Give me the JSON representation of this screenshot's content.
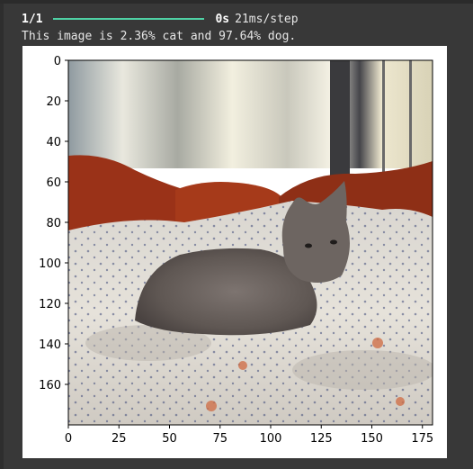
{
  "output": {
    "progress": {
      "step_count": "1/1",
      "fraction_complete": 1.0,
      "time": "0s",
      "rate": "21ms/step"
    },
    "result_text": "This image is 2.36% cat and 97.64% dog."
  },
  "figure": {
    "image_subject": "cat lying on a patterned bedspread in front of a window",
    "x_ticks": [
      "0",
      "25",
      "50",
      "75",
      "100",
      "125",
      "150",
      "175"
    ],
    "y_ticks": [
      "0",
      "20",
      "40",
      "60",
      "80",
      "100",
      "120",
      "140",
      "160"
    ],
    "x_range": [
      0,
      180
    ],
    "y_range": [
      0,
      180
    ]
  },
  "colors": {
    "bar_fill": "#4fd1a5",
    "cell_bg": "#383838"
  }
}
